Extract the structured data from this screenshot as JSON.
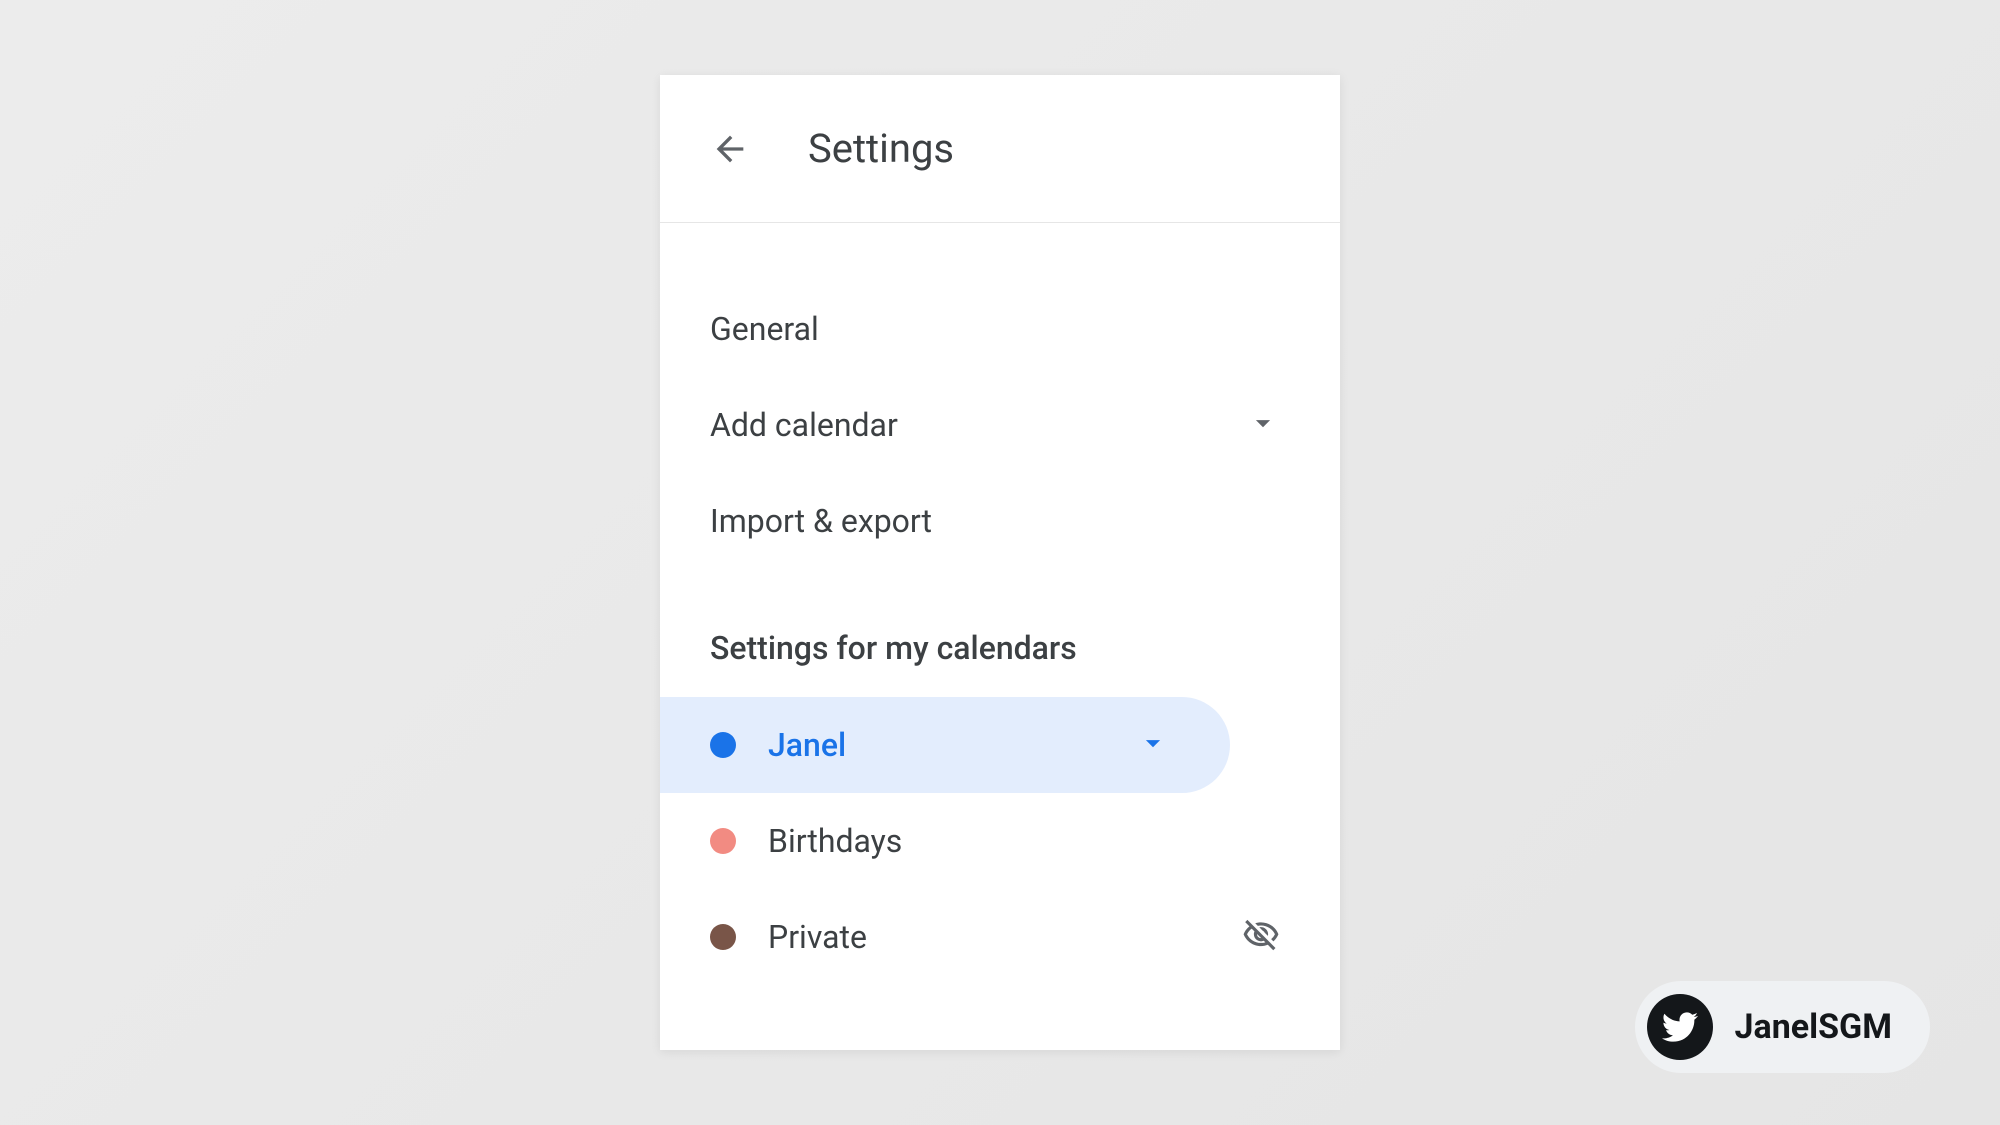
{
  "header": {
    "title": "Settings"
  },
  "menu": {
    "general": "General",
    "add_calendar": "Add calendar",
    "import_export": "Import & export"
  },
  "section_header": "Settings for my calendars",
  "calendars": [
    {
      "name": "Janel",
      "color": "#1a73e8",
      "selected": true,
      "hidden": false
    },
    {
      "name": "Birthdays",
      "color": "#f28b82",
      "selected": false,
      "hidden": false
    },
    {
      "name": "Private",
      "color": "#795548",
      "selected": false,
      "hidden": true
    }
  ],
  "badge": {
    "handle": "JanelSGM"
  }
}
